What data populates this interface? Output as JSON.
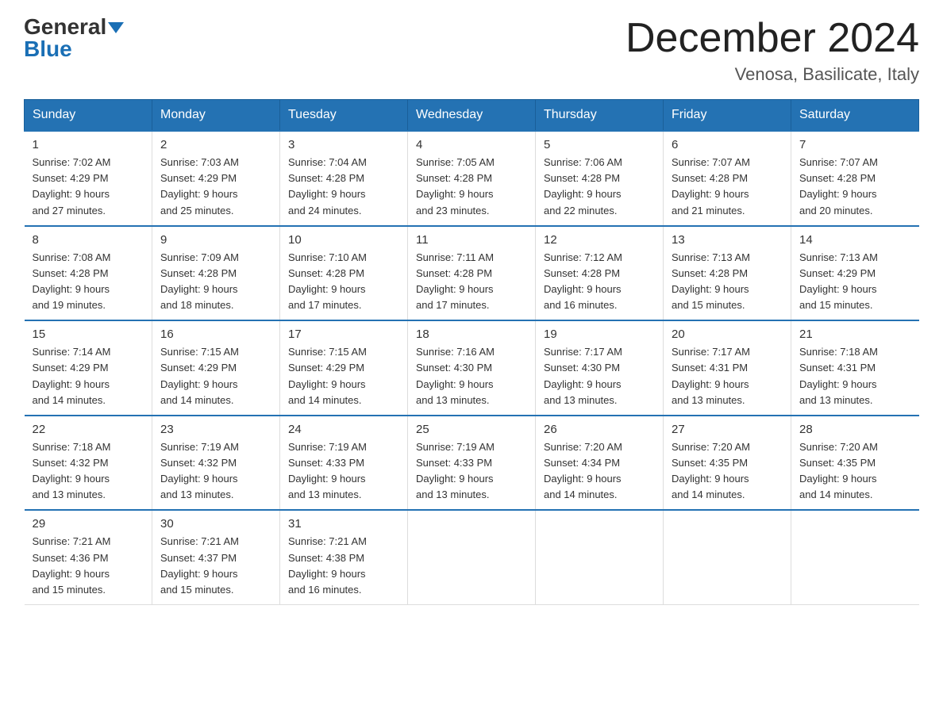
{
  "header": {
    "logo_general": "General",
    "logo_blue": "Blue",
    "month_title": "December 2024",
    "location": "Venosa, Basilicate, Italy"
  },
  "weekdays": [
    "Sunday",
    "Monday",
    "Tuesday",
    "Wednesday",
    "Thursday",
    "Friday",
    "Saturday"
  ],
  "weeks": [
    [
      {
        "day": "1",
        "sunrise": "7:02 AM",
        "sunset": "4:29 PM",
        "daylight": "9 hours and 27 minutes."
      },
      {
        "day": "2",
        "sunrise": "7:03 AM",
        "sunset": "4:29 PM",
        "daylight": "9 hours and 25 minutes."
      },
      {
        "day": "3",
        "sunrise": "7:04 AM",
        "sunset": "4:28 PM",
        "daylight": "9 hours and 24 minutes."
      },
      {
        "day": "4",
        "sunrise": "7:05 AM",
        "sunset": "4:28 PM",
        "daylight": "9 hours and 23 minutes."
      },
      {
        "day": "5",
        "sunrise": "7:06 AM",
        "sunset": "4:28 PM",
        "daylight": "9 hours and 22 minutes."
      },
      {
        "day": "6",
        "sunrise": "7:07 AM",
        "sunset": "4:28 PM",
        "daylight": "9 hours and 21 minutes."
      },
      {
        "day": "7",
        "sunrise": "7:07 AM",
        "sunset": "4:28 PM",
        "daylight": "9 hours and 20 minutes."
      }
    ],
    [
      {
        "day": "8",
        "sunrise": "7:08 AM",
        "sunset": "4:28 PM",
        "daylight": "9 hours and 19 minutes."
      },
      {
        "day": "9",
        "sunrise": "7:09 AM",
        "sunset": "4:28 PM",
        "daylight": "9 hours and 18 minutes."
      },
      {
        "day": "10",
        "sunrise": "7:10 AM",
        "sunset": "4:28 PM",
        "daylight": "9 hours and 17 minutes."
      },
      {
        "day": "11",
        "sunrise": "7:11 AM",
        "sunset": "4:28 PM",
        "daylight": "9 hours and 17 minutes."
      },
      {
        "day": "12",
        "sunrise": "7:12 AM",
        "sunset": "4:28 PM",
        "daylight": "9 hours and 16 minutes."
      },
      {
        "day": "13",
        "sunrise": "7:13 AM",
        "sunset": "4:28 PM",
        "daylight": "9 hours and 15 minutes."
      },
      {
        "day": "14",
        "sunrise": "7:13 AM",
        "sunset": "4:29 PM",
        "daylight": "9 hours and 15 minutes."
      }
    ],
    [
      {
        "day": "15",
        "sunrise": "7:14 AM",
        "sunset": "4:29 PM",
        "daylight": "9 hours and 14 minutes."
      },
      {
        "day": "16",
        "sunrise": "7:15 AM",
        "sunset": "4:29 PM",
        "daylight": "9 hours and 14 minutes."
      },
      {
        "day": "17",
        "sunrise": "7:15 AM",
        "sunset": "4:29 PM",
        "daylight": "9 hours and 14 minutes."
      },
      {
        "day": "18",
        "sunrise": "7:16 AM",
        "sunset": "4:30 PM",
        "daylight": "9 hours and 13 minutes."
      },
      {
        "day": "19",
        "sunrise": "7:17 AM",
        "sunset": "4:30 PM",
        "daylight": "9 hours and 13 minutes."
      },
      {
        "day": "20",
        "sunrise": "7:17 AM",
        "sunset": "4:31 PM",
        "daylight": "9 hours and 13 minutes."
      },
      {
        "day": "21",
        "sunrise": "7:18 AM",
        "sunset": "4:31 PM",
        "daylight": "9 hours and 13 minutes."
      }
    ],
    [
      {
        "day": "22",
        "sunrise": "7:18 AM",
        "sunset": "4:32 PM",
        "daylight": "9 hours and 13 minutes."
      },
      {
        "day": "23",
        "sunrise": "7:19 AM",
        "sunset": "4:32 PM",
        "daylight": "9 hours and 13 minutes."
      },
      {
        "day": "24",
        "sunrise": "7:19 AM",
        "sunset": "4:33 PM",
        "daylight": "9 hours and 13 minutes."
      },
      {
        "day": "25",
        "sunrise": "7:19 AM",
        "sunset": "4:33 PM",
        "daylight": "9 hours and 13 minutes."
      },
      {
        "day": "26",
        "sunrise": "7:20 AM",
        "sunset": "4:34 PM",
        "daylight": "9 hours and 14 minutes."
      },
      {
        "day": "27",
        "sunrise": "7:20 AM",
        "sunset": "4:35 PM",
        "daylight": "9 hours and 14 minutes."
      },
      {
        "day": "28",
        "sunrise": "7:20 AM",
        "sunset": "4:35 PM",
        "daylight": "9 hours and 14 minutes."
      }
    ],
    [
      {
        "day": "29",
        "sunrise": "7:21 AM",
        "sunset": "4:36 PM",
        "daylight": "9 hours and 15 minutes."
      },
      {
        "day": "30",
        "sunrise": "7:21 AM",
        "sunset": "4:37 PM",
        "daylight": "9 hours and 15 minutes."
      },
      {
        "day": "31",
        "sunrise": "7:21 AM",
        "sunset": "4:38 PM",
        "daylight": "9 hours and 16 minutes."
      },
      null,
      null,
      null,
      null
    ]
  ],
  "labels": {
    "sunrise": "Sunrise:",
    "sunset": "Sunset:",
    "daylight": "Daylight:"
  }
}
